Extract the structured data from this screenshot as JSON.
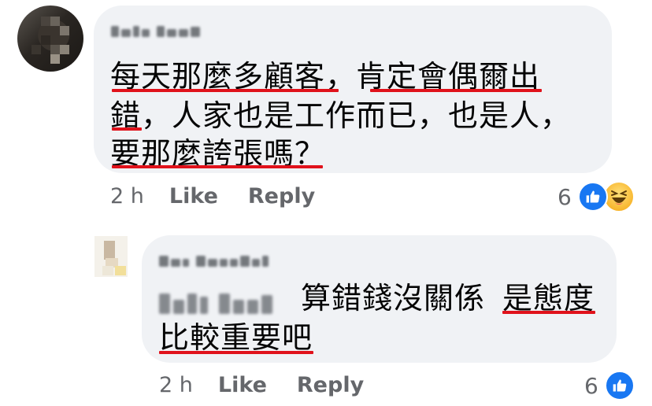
{
  "comments": [
    {
      "lines": [
        "每天那麼多顧客，肯定會偶爾出",
        "錯，人家也是工作而已，也是人，",
        "要那麼誇張嗎？"
      ],
      "time": "2 h",
      "like_label": "Like",
      "reply_label": "Reply",
      "reaction_count": "6",
      "reactions": [
        "like-icon",
        "haha-icon"
      ]
    },
    {
      "text_part1": "算錯錢沒關係",
      "text_part2": "是態度",
      "line2": "比較重要吧",
      "time": "2 h",
      "like_label": "Like",
      "reply_label": "Reply",
      "reaction_count": "6",
      "reactions": [
        "like-icon"
      ]
    }
  ],
  "colors": {
    "bubble": "#f0f2f5",
    "underline": "#e0121b",
    "like": "#1877f2",
    "meta": "#65676b"
  }
}
